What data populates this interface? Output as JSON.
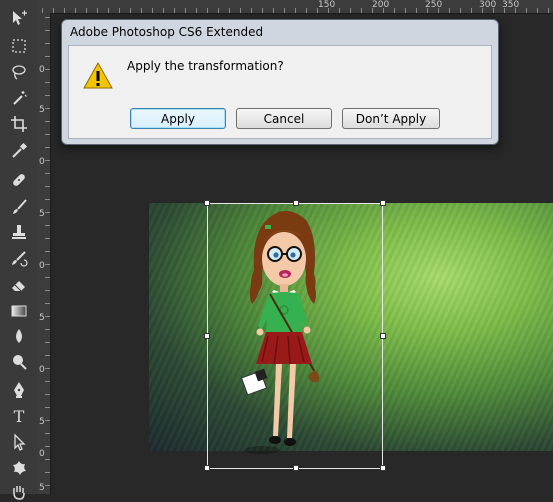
{
  "app": "Adobe Photoshop CS6 Extended",
  "dialog": {
    "title": "Adobe Photoshop CS6 Extended",
    "message": "Apply the transformation?",
    "buttons": {
      "apply": "Apply",
      "cancel": "Cancel",
      "dont_apply": "Don’t Apply"
    },
    "icon": "warning-icon"
  },
  "ruler_top": {
    "labels": [
      "150",
      "200",
      "250",
      "300",
      "350"
    ]
  },
  "ruler_left": {
    "labels": [
      "0",
      "5",
      "0",
      "5",
      "0",
      "5",
      "0",
      "5",
      "0",
      "5"
    ]
  },
  "toolbar": {
    "tools": [
      "move-icon",
      "marquee-icon",
      "lasso-icon",
      "magic-wand-icon",
      "crop-icon",
      "eyedropper-icon",
      "healing-brush-icon",
      "brush-icon",
      "clone-stamp-icon",
      "history-brush-icon",
      "eraser-icon",
      "gradient-icon",
      "blur-icon",
      "dodge-icon",
      "pen-icon",
      "type-icon",
      "path-selection-icon",
      "custom-shape-icon",
      "hand-icon"
    ]
  },
  "colors": {
    "accent": "#3c7fb1",
    "warning": "#f5c400",
    "canvas_light": "#a7dd6a",
    "canvas_dark": "#1d2a2e"
  }
}
